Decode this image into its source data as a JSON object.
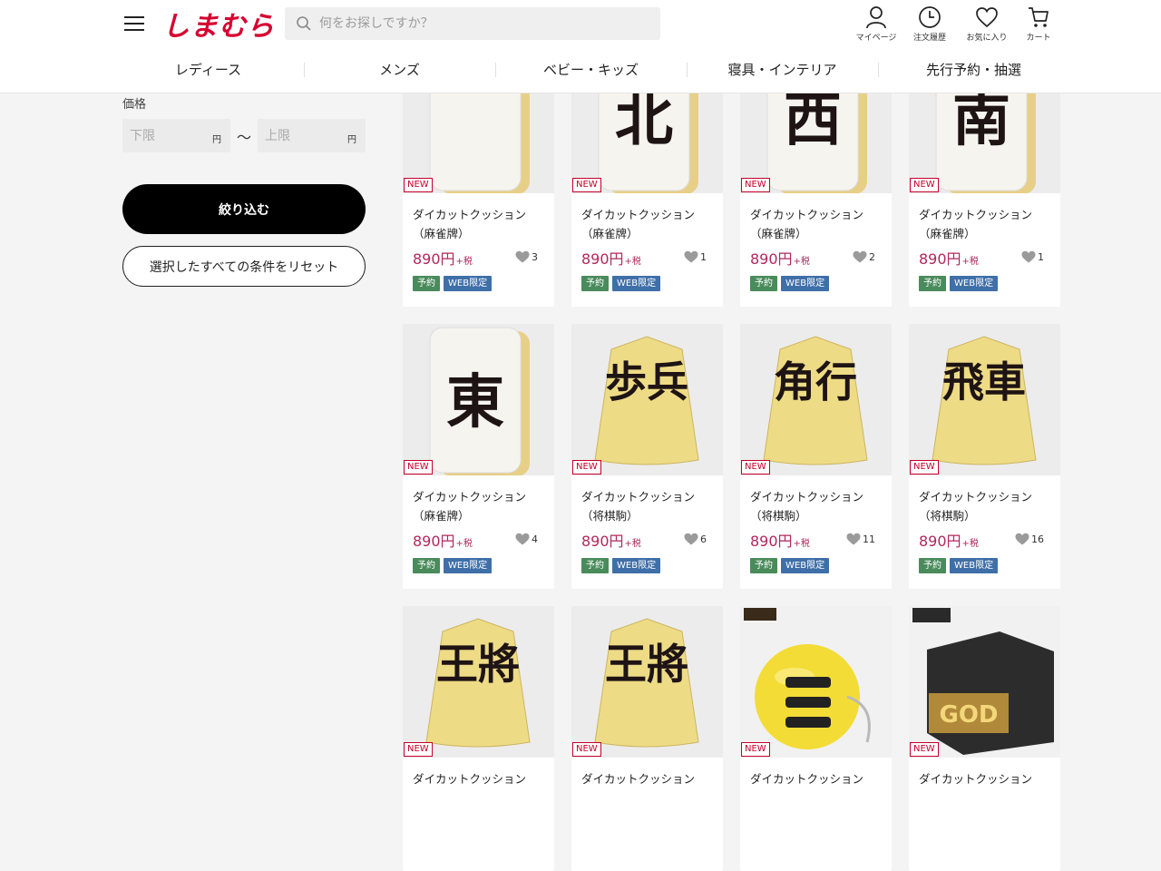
{
  "header": {
    "logo": "しまむら",
    "search_placeholder": "何をお探しですか？",
    "utilities": [
      {
        "label": "マイページ",
        "icon": "user-icon"
      },
      {
        "label": "注文履歴",
        "icon": "clock-icon"
      },
      {
        "label": "お気に入り",
        "icon": "heart-icon"
      },
      {
        "label": "カート",
        "icon": "cart-icon"
      }
    ],
    "categories": [
      "レディース",
      "メンズ",
      "ベビー・キッズ",
      "寝具・インテリア",
      "先行予約・抽選"
    ]
  },
  "filter": {
    "price_label": "価格",
    "min_placeholder": "下限",
    "max_placeholder": "上限",
    "yen": "円",
    "tilde": "〜",
    "apply_button": "絞り込む",
    "reset_button": "選択したすべての条件をリセット"
  },
  "colors": {
    "brand": "#d6002f",
    "price": "#b0285a",
    "tag_reserve": "#4a8b5c",
    "tag_web": "#3f6fa8"
  },
  "products": [
    {
      "new": "NEW",
      "name1": "ダイカットクッション",
      "name2": "（麻雀牌）",
      "price": "890円",
      "tax": "+税",
      "favs": "3",
      "tags": [
        "予約",
        "WEB限定"
      ],
      "glyph": "",
      "kind": "mahjong"
    },
    {
      "new": "NEW",
      "name1": "ダイカットクッション",
      "name2": "（麻雀牌）",
      "price": "890円",
      "tax": "+税",
      "favs": "1",
      "tags": [
        "予約",
        "WEB限定"
      ],
      "glyph": "北",
      "kind": "mahjong"
    },
    {
      "new": "NEW",
      "name1": "ダイカットクッション",
      "name2": "（麻雀牌）",
      "price": "890円",
      "tax": "+税",
      "favs": "2",
      "tags": [
        "予約",
        "WEB限定"
      ],
      "glyph": "西",
      "kind": "mahjong"
    },
    {
      "new": "NEW",
      "name1": "ダイカットクッション",
      "name2": "（麻雀牌）",
      "price": "890円",
      "tax": "+税",
      "favs": "1",
      "tags": [
        "予約",
        "WEB限定"
      ],
      "glyph": "南",
      "kind": "mahjong"
    },
    {
      "new": "NEW",
      "name1": "ダイカットクッション",
      "name2": "（麻雀牌）",
      "price": "890円",
      "tax": "+税",
      "favs": "4",
      "tags": [
        "予約",
        "WEB限定"
      ],
      "glyph": "東",
      "kind": "mahjong"
    },
    {
      "new": "NEW",
      "name1": "ダイカットクッション",
      "name2": "（将棋駒）",
      "price": "890円",
      "tax": "+税",
      "favs": "6",
      "tags": [
        "予約",
        "WEB限定"
      ],
      "glyph": "歩兵",
      "kind": "shogi"
    },
    {
      "new": "NEW",
      "name1": "ダイカットクッション",
      "name2": "（将棋駒）",
      "price": "890円",
      "tax": "+税",
      "favs": "11",
      "tags": [
        "予約",
        "WEB限定"
      ],
      "glyph": "角行",
      "kind": "shogi"
    },
    {
      "new": "NEW",
      "name1": "ダイカットクッション",
      "name2": "（将棋駒）",
      "price": "890円",
      "tax": "+税",
      "favs": "16",
      "tags": [
        "予約",
        "WEB限定"
      ],
      "glyph": "飛車",
      "kind": "shogi"
    },
    {
      "new": "NEW",
      "name1": "ダイカットクッション",
      "name2": "",
      "price": "",
      "tax": "",
      "favs": "",
      "tags": [],
      "glyph": "王將",
      "kind": "shogi"
    },
    {
      "new": "NEW",
      "name1": "ダイカットクッション",
      "name2": "",
      "price": "",
      "tax": "",
      "favs": "",
      "tags": [],
      "glyph": "王將",
      "kind": "shogi"
    },
    {
      "new": "NEW",
      "name1": "ダイカットクッション",
      "name2": "",
      "price": "",
      "tax": "",
      "favs": "",
      "tags": [],
      "glyph": "",
      "kind": "ball"
    },
    {
      "new": "NEW",
      "name1": "ダイカットクッション",
      "name2": "",
      "price": "",
      "tax": "",
      "favs": "",
      "tags": [],
      "glyph": "GOD",
      "kind": "cube"
    }
  ]
}
